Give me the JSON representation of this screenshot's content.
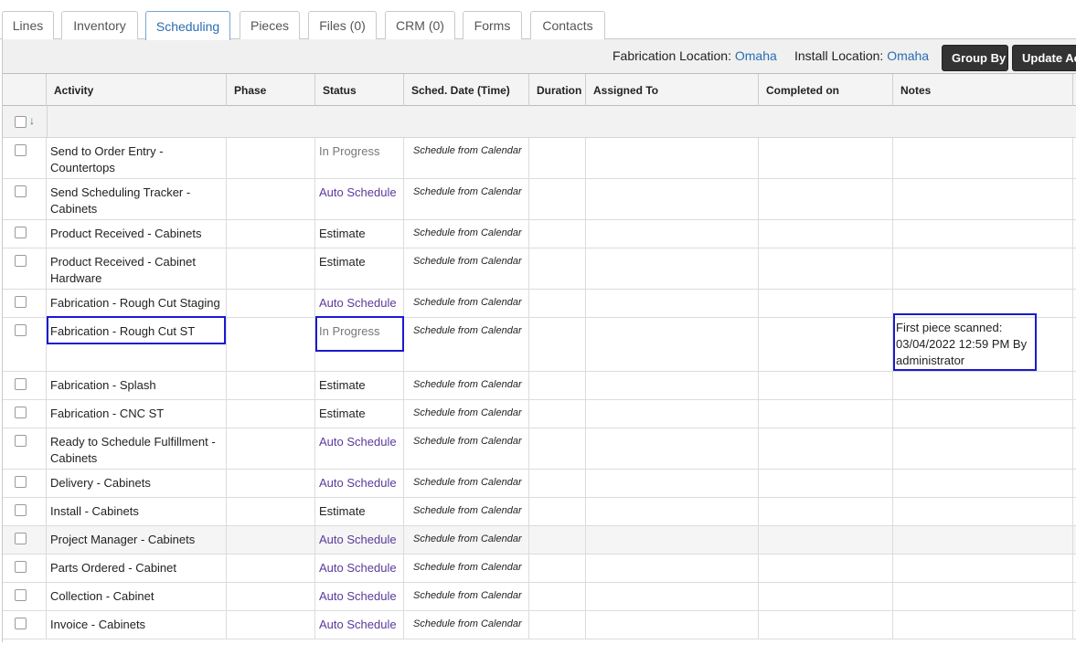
{
  "tabs": [
    {
      "label": "Lines",
      "active": false
    },
    {
      "label": "Inventory",
      "active": false
    },
    {
      "label": "Scheduling",
      "active": true
    },
    {
      "label": "Pieces",
      "active": false
    },
    {
      "label": "Files (0)",
      "active": false
    },
    {
      "label": "CRM (0)",
      "active": false
    },
    {
      "label": "Forms",
      "active": false
    },
    {
      "label": "Contacts",
      "active": false
    }
  ],
  "toolbar": {
    "fab_label": "Fabrication Location:",
    "fab_value": "Omaha",
    "install_label": "Install Location:",
    "install_value": "Omaha",
    "group_by": "Group By",
    "update": "Update Ac"
  },
  "columns": [
    "Activity",
    "Phase",
    "Status",
    "Sched. Date (Time)",
    "Duration",
    "Assigned To",
    "Completed on",
    "Notes"
  ],
  "rows": [
    {
      "activity": [
        "Send to Order Entry -",
        "Countertops"
      ],
      "status": "In Progress",
      "status_kind": "progress",
      "sched": "Schedule from Calendar",
      "notes": []
    },
    {
      "activity": [
        "Send Scheduling Tracker -",
        "Cabinets"
      ],
      "status": "Auto Schedule",
      "status_kind": "auto",
      "sched": "Schedule from Calendar",
      "notes": []
    },
    {
      "activity": [
        "Product Received - Cabinets"
      ],
      "status": "Estimate",
      "status_kind": "estimate",
      "sched": "Schedule from Calendar",
      "notes": []
    },
    {
      "activity": [
        "Product Received - Cabinet",
        "Hardware"
      ],
      "status": "Estimate",
      "status_kind": "estimate",
      "sched": "Schedule from Calendar",
      "notes": []
    },
    {
      "activity": [
        "Fabrication - Rough Cut Staging"
      ],
      "status": "Auto Schedule",
      "status_kind": "auto",
      "sched": "Schedule from Calendar",
      "notes": []
    },
    {
      "activity": [
        "Fabrication - Rough Cut ST"
      ],
      "status": "In Progress",
      "status_kind": "progress",
      "sched": "Schedule from Calendar",
      "notes": [
        "First piece scanned:",
        "03/04/2022 12:59 PM By",
        "administrator"
      ]
    },
    {
      "activity": [
        "Fabrication - Splash"
      ],
      "status": "Estimate",
      "status_kind": "estimate",
      "sched": "Schedule from Calendar",
      "notes": []
    },
    {
      "activity": [
        "Fabrication - CNC ST"
      ],
      "status": "Estimate",
      "status_kind": "estimate",
      "sched": "Schedule from Calendar",
      "notes": []
    },
    {
      "activity": [
        "Ready to Schedule Fulfillment -",
        "Cabinets"
      ],
      "status": "Auto Schedule",
      "status_kind": "auto",
      "sched": "Schedule from Calendar",
      "notes": []
    },
    {
      "activity": [
        "Delivery - Cabinets"
      ],
      "status": "Auto Schedule",
      "status_kind": "auto",
      "sched": "Schedule from Calendar",
      "notes": []
    },
    {
      "activity": [
        "Install - Cabinets"
      ],
      "status": "Estimate",
      "status_kind": "estimate",
      "sched": "Schedule from Calendar",
      "notes": []
    },
    {
      "activity": [
        "Project Manager - Cabinets"
      ],
      "status": "Auto Schedule",
      "status_kind": "auto",
      "sched": "Schedule from Calendar",
      "notes": []
    },
    {
      "activity": [
        "Parts Ordered - Cabinet"
      ],
      "status": "Auto Schedule",
      "status_kind": "auto",
      "sched": "Schedule from Calendar",
      "notes": []
    },
    {
      "activity": [
        "Collection - Cabinet"
      ],
      "status": "Auto Schedule",
      "status_kind": "auto",
      "sched": "Schedule from Calendar",
      "notes": []
    },
    {
      "activity": [
        "Invoice - Cabinets"
      ],
      "status": "Auto Schedule",
      "status_kind": "auto",
      "sched": "Schedule from Calendar",
      "notes": []
    }
  ],
  "sort_icon": "sort-down-arrow-icon",
  "colors": {
    "accent": "#2a6db3",
    "auto_schedule": "#5b3a9a",
    "highlight_box": "#1a1ad1"
  }
}
